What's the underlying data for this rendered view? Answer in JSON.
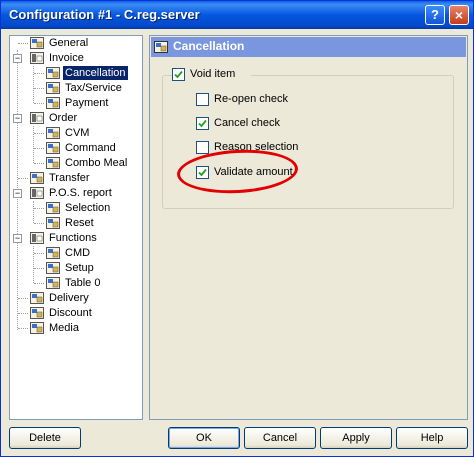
{
  "window": {
    "title": "Configuration #1 - C.reg.server",
    "help_label": "?",
    "close_label": "×"
  },
  "tree": {
    "items": [
      {
        "label": "General"
      },
      {
        "label": "Invoice",
        "expander": "−"
      },
      {
        "label": "Cancellation",
        "selected": true
      },
      {
        "label": "Tax/Service"
      },
      {
        "label": "Payment"
      },
      {
        "label": "Order",
        "expander": "−"
      },
      {
        "label": "CVM"
      },
      {
        "label": "Command"
      },
      {
        "label": "Combo Meal"
      },
      {
        "label": "Transfer"
      },
      {
        "label": "P.O.S. report",
        "expander": "−"
      },
      {
        "label": "Selection"
      },
      {
        "label": "Reset"
      },
      {
        "label": "Functions",
        "expander": "−"
      },
      {
        "label": "CMD"
      },
      {
        "label": "Setup"
      },
      {
        "label": "Table 0"
      },
      {
        "label": "Delivery"
      },
      {
        "label": "Discount"
      },
      {
        "label": "Media"
      }
    ]
  },
  "panel": {
    "title": "Cancellation",
    "void_item": {
      "label": "Void item",
      "checked": true
    },
    "options": [
      {
        "label": "Re-open check",
        "checked": false
      },
      {
        "label": "Cancel check",
        "checked": true
      },
      {
        "label": "Reason selection",
        "checked": false
      },
      {
        "label": "Validate amount",
        "checked": true
      }
    ]
  },
  "buttons": {
    "delete": "Delete",
    "ok": "OK",
    "cancel": "Cancel",
    "apply": "Apply",
    "help": "Help"
  },
  "colors": {
    "title_bar": "#0557e0",
    "selection": "#0a246a",
    "panel_header": "#7a96df",
    "highlight_ellipse": "#e20000"
  }
}
